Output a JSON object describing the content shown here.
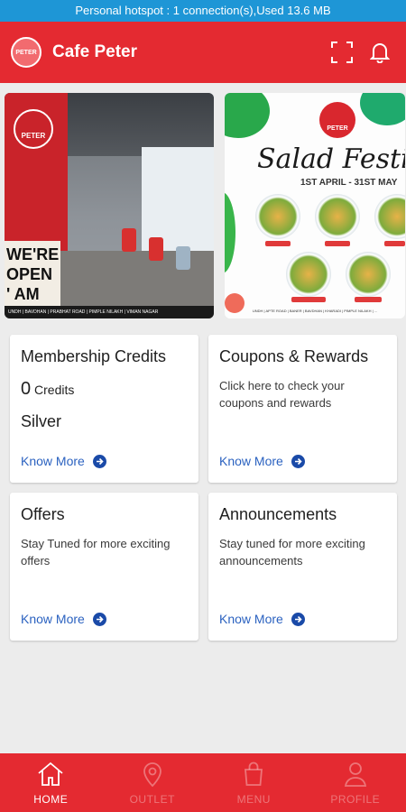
{
  "status_bar": {
    "text": "Personal hotspot : 1 connection(s),Used  13.6 MB"
  },
  "app_bar": {
    "title": "Cafe Peter",
    "logo_text": "PETER"
  },
  "banners": {
    "cafe": {
      "logo_text": "PETER",
      "open_line1": "WE'RE",
      "open_line2": "OPEN",
      "open_line3": "' AM",
      "strip": "UNDH | BAVDHAN | PRABHAT ROAD | PIMPLE NILAKH | VIMAN NAGAR"
    },
    "salad": {
      "logo_text": "PETER",
      "title": "Salad Festiva",
      "date": "1ST APRIL - 31ST MAY",
      "footer": "UNDH | APTE ROAD | BANER | BAVDHAN | KHARADI | PIMPLE NILAKH | ..."
    }
  },
  "cards": {
    "membership": {
      "title": "Membership Credits",
      "credits_value": "0",
      "credits_label": "Credits",
      "tier": "Silver",
      "link": "Know More"
    },
    "coupons": {
      "title": "Coupons & Rewards",
      "desc": "Click here to check your coupons and rewards",
      "link": "Know More"
    },
    "offers": {
      "title": "Offers",
      "desc": "Stay Tuned for more exciting offers",
      "link": "Know More"
    },
    "announcements": {
      "title": "Announcements",
      "desc": "Stay tuned for more exciting announcements",
      "link": "Know More"
    }
  },
  "bottom_nav": [
    {
      "label": "HOME",
      "icon": "home-icon",
      "active": true
    },
    {
      "label": "OUTLET",
      "icon": "location-pin-icon",
      "active": false
    },
    {
      "label": "MENU",
      "icon": "shopping-bag-icon",
      "active": false
    },
    {
      "label": "PROFILE",
      "icon": "user-icon",
      "active": false
    }
  ],
  "colors": {
    "primary": "#e42a31",
    "status_bar": "#1e96d6",
    "link": "#2b62c0",
    "background": "#ececec"
  }
}
